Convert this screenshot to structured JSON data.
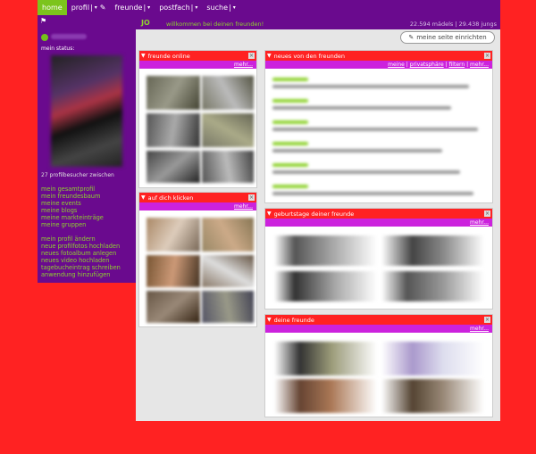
{
  "nav": {
    "home": "home",
    "profil": "profil",
    "freunde": "freunde",
    "postfach": "postfach",
    "suche": "suche",
    "sep": "|",
    "drop": "▾"
  },
  "sidebar": {
    "status": "mein status:",
    "count": "27 profilbesucher zwischen",
    "links_a": [
      "mein gesamtprofil",
      "mein freundesbaum",
      "meine events",
      "meine blogs",
      "meine markteinträge",
      "meine gruppen"
    ],
    "links_b": [
      "mein profil ändern",
      "neue profilfotos hochladen",
      "neues fotoalbum anlegen",
      "neues video hochladen",
      "tagebucheintrag schreiben",
      "anwendung hinzufügen"
    ]
  },
  "header": {
    "logo": "JO",
    "welcome": "willkommen bei deinen freunden!",
    "stats": "22.594 mädels | 29.438 jungs",
    "setup_button": "meine seite einrichten"
  },
  "panels": {
    "friends_online": {
      "title": "freunde online",
      "more": "mehr..."
    },
    "clicked_you": {
      "title": "auf dich klicken",
      "more": "mehr..."
    },
    "news": {
      "title": "neues von den freunden",
      "links": [
        "meine",
        "privatsphäre",
        "filtern",
        "mehr..."
      ]
    },
    "birthdays": {
      "title": "geburtstage deiner freunde",
      "more": "mehr..."
    },
    "your_friends": {
      "title": "deine freunde",
      "more": "mehr..."
    }
  },
  "colors": {
    "purple": "#6a0a8e",
    "green": "#7cc41c",
    "red": "#ff2222",
    "magenta": "#cc22dd"
  }
}
